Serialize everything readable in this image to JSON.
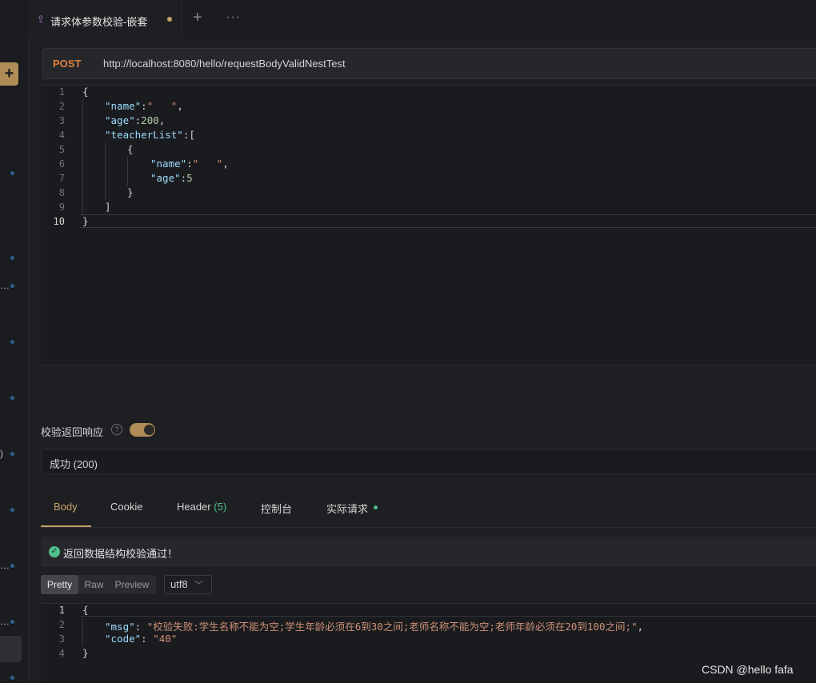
{
  "tab": {
    "title": "请求体参数校验-嵌套",
    "add_icon": "+",
    "more_icon": "···"
  },
  "sidebar": {
    "add_label": "+",
    "edge_marks": [
      "…",
      "…",
      ")",
      "…",
      "…"
    ]
  },
  "request": {
    "method": "POST",
    "url": "http://localhost:8080/hello/requestBodyValidNestTest"
  },
  "request_body": {
    "line_numbers": [
      "1",
      "2",
      "3",
      "4",
      "5",
      "6",
      "7",
      "8",
      "9",
      "10"
    ],
    "lines": [
      "{",
      "\"name\":\"   \",",
      "\"age\":200,",
      "\"teacherList\":[",
      "{",
      "\"name\":\"   \",",
      "\"age\":5",
      "}",
      "]",
      "}"
    ]
  },
  "validate": {
    "label": "校验返回响应",
    "help_icon": "?",
    "enabled": true
  },
  "status": {
    "text": "成功 (200)"
  },
  "response_tabs": {
    "body": "Body",
    "cookie": "Cookie",
    "header": "Header",
    "header_count": "(5)",
    "console": "控制台",
    "actual_request": "实际请求"
  },
  "validation_result": {
    "icon": "check-circle",
    "text": "返回数据结构校验通过！"
  },
  "format": {
    "pretty": "Pretty",
    "raw": "Raw",
    "preview": "Preview",
    "encoding": "utf8"
  },
  "response_body": {
    "line_numbers": [
      "1",
      "2",
      "3",
      "4"
    ],
    "lines": [
      "{",
      "\"msg\": \"校验失败:学生名称不能为空;学生年龄必须在6到30之间;老师名称不能为空;老师年龄必须在20到100之间;\",",
      "\"code\": \"40\"",
      "}"
    ]
  },
  "watermark": "CSDN @hello fafa",
  "colors": {
    "accent": "#c8a26a",
    "method": "#e0823d",
    "success": "#4fc08d",
    "key": "#9cdcfe",
    "string": "#ce9178",
    "number": "#b5cea8"
  }
}
